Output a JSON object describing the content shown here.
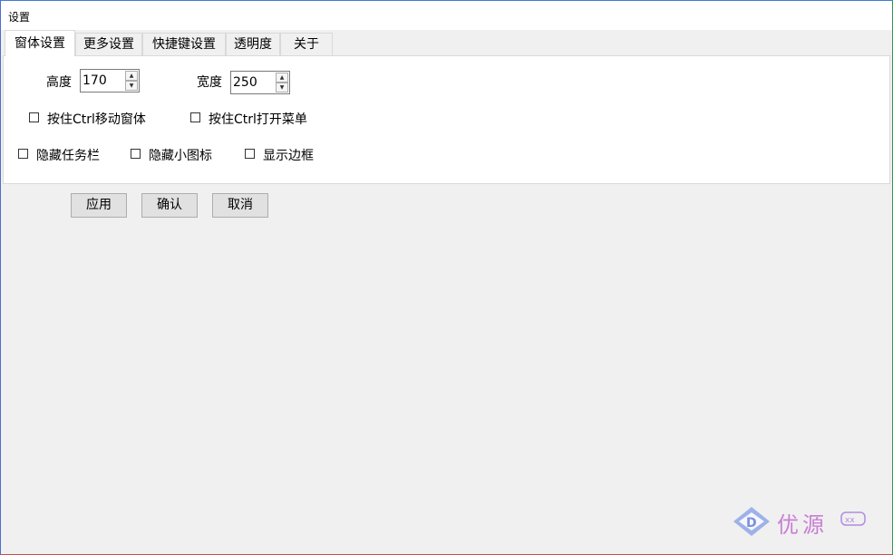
{
  "window": {
    "title": "设置"
  },
  "tabs": [
    {
      "label": "窗体设置",
      "active": true
    },
    {
      "label": "更多设置",
      "active": false
    },
    {
      "label": "快捷键设置",
      "active": false
    },
    {
      "label": "透明度",
      "active": false
    },
    {
      "label": "关于",
      "active": false
    }
  ],
  "size": {
    "height_label": "高度",
    "height_value": "170",
    "width_label": "宽度",
    "width_value": "250"
  },
  "checkboxes": {
    "ctrl_move": {
      "label": "按住Ctrl移动窗体",
      "checked": false
    },
    "ctrl_menu": {
      "label": "按住Ctrl打开菜单",
      "checked": false
    },
    "hide_taskbar": {
      "label": "隐藏任务栏",
      "checked": false
    },
    "hide_tray": {
      "label": "隐藏小图标",
      "checked": false
    },
    "show_border": {
      "label": "显示边框",
      "checked": false
    }
  },
  "buttons": {
    "apply": "应用",
    "confirm": "确认",
    "cancel": "取消"
  },
  "watermark": {
    "text": "优源"
  },
  "colors": {
    "accent": "#c97fd4",
    "panel_bg": "#ffffff",
    "window_bg": "#f0f0f0"
  }
}
